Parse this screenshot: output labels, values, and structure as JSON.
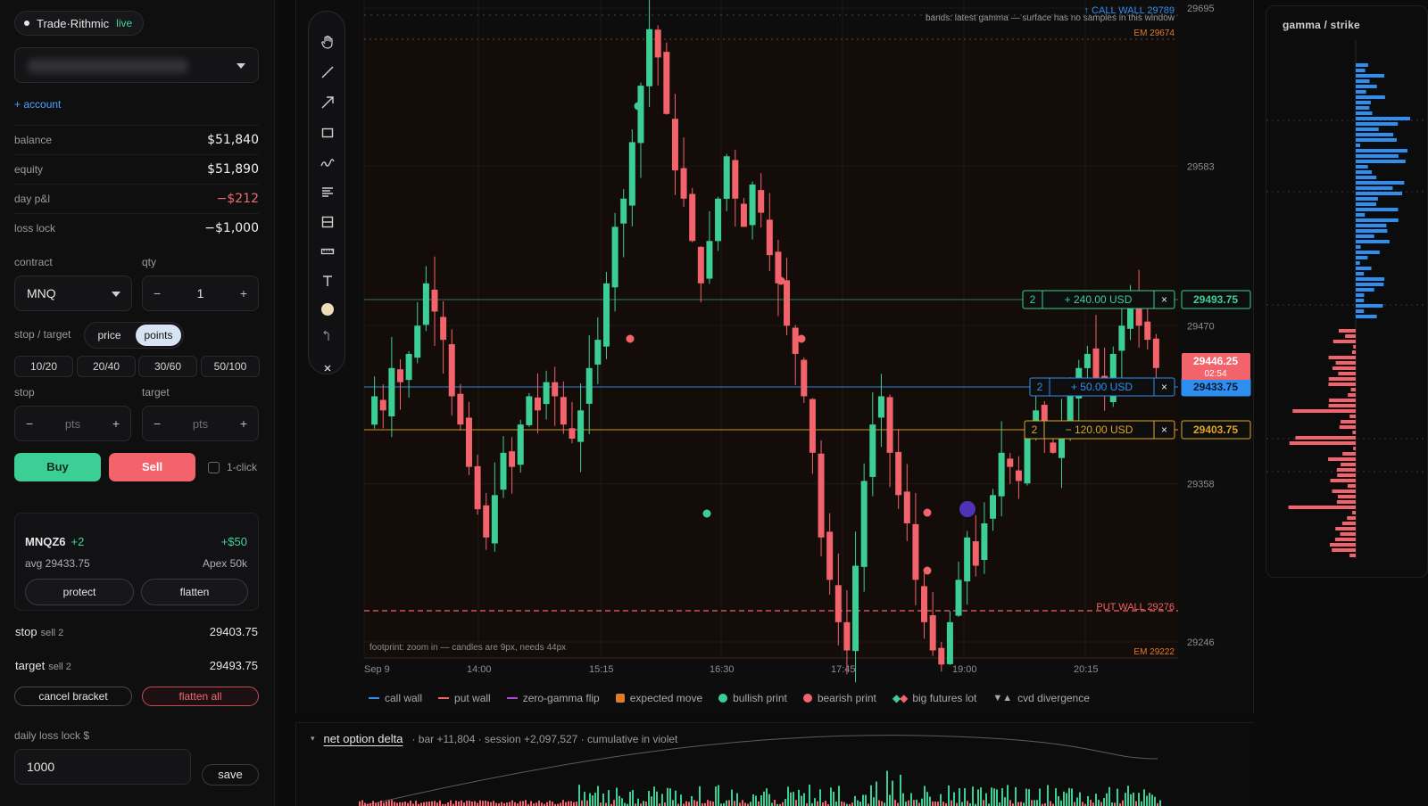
{
  "broker": {
    "name": "Trade·Rithmic",
    "status": "live"
  },
  "account": {
    "add_label": "+ account"
  },
  "stats": [
    {
      "key": "balance",
      "value": "$51,840",
      "negative": false
    },
    {
      "key": "equity",
      "value": "$51,890",
      "negative": false
    },
    {
      "key": "day p&l",
      "value": "−$212",
      "negative": true
    },
    {
      "key": "loss lock",
      "value": "−$1,000",
      "negative": false
    }
  ],
  "order_form": {
    "contract_label": "contract",
    "contract_value": "MNQ",
    "qty_label": "qty",
    "qty_value": "1",
    "minus": "−",
    "plus": "+",
    "stop_target_label": "stop / target",
    "mode_options": [
      "price",
      "points"
    ],
    "mode_selected": "points",
    "presets": [
      "10/20",
      "20/40",
      "30/60",
      "50/100"
    ],
    "stop_label": "stop",
    "target_label": "target",
    "pts_placeholder": "pts",
    "buy_label": "Buy",
    "sell_label": "Sell",
    "one_click_label": "1-click"
  },
  "position": {
    "symbol": "MNQZ6",
    "count": "+2",
    "pnl": "+$50",
    "avg": "avg 29433.75",
    "account": "Apex 50k",
    "protect_label": "protect",
    "flatten_label": "flatten"
  },
  "working_orders": [
    {
      "kind": "stop",
      "side": "sell 2",
      "price": "29403.75"
    },
    {
      "kind": "target",
      "side": "sell 2",
      "price": "29493.75"
    }
  ],
  "actions": {
    "cancel_bracket": "cancel bracket",
    "flatten_all": "flatten all"
  },
  "loss_lock": {
    "label": "daily loss lock $",
    "value": "1000",
    "save_label": "save"
  },
  "chart": {
    "price_axis": [
      "29695",
      "29583",
      "29470",
      "29358",
      "29246"
    ],
    "time_axis": [
      "Sep 9",
      "14:00",
      "15:15",
      "16:30",
      "17:45",
      "19:00",
      "20:15"
    ],
    "call_wall_label": "↑ CALL WALL 29789",
    "bands_note": "bands: latest gamma — surface has no samples in this window",
    "em_upper": "EM 29674",
    "em_lower": "EM 29222",
    "put_wall_label": "PUT WALL 29276",
    "footprint_note": "footprint: zoom in — candles are 9px, needs 44px",
    "last_price": "29446.25",
    "countdown": "02:54",
    "orders": [
      {
        "qty": "2",
        "pnl": "+ 240.00 USD",
        "price": "29493.75",
        "color": "#3ccf95"
      },
      {
        "qty": "2",
        "pnl": "+ 50.00 USD",
        "price": "29433.75",
        "color": "#2f8ff0"
      },
      {
        "qty": "2",
        "pnl": "− 120.00 USD",
        "price": "29403.75",
        "color": "#e0a623"
      }
    ],
    "close_glyph": "×",
    "colors": {
      "up": "#3ccf95",
      "down": "#f2636c",
      "call_wall": "#2f8ff0",
      "put_wall": "#f2636c",
      "em": "#e07b2a"
    }
  },
  "legend": [
    {
      "label": "call wall",
      "swatch": "line",
      "color": "#2f8ff0"
    },
    {
      "label": "put wall",
      "swatch": "line",
      "color": "#f2636c"
    },
    {
      "label": "zero-gamma flip",
      "swatch": "line",
      "color": "#b04ad8"
    },
    {
      "label": "expected move",
      "swatch": "square",
      "color": "#e07b2a"
    },
    {
      "label": "bullish print",
      "swatch": "dot",
      "color": "#3ccf95"
    },
    {
      "label": "bearish print",
      "swatch": "dot",
      "color": "#f2636c"
    },
    {
      "label": "big futures lot",
      "swatch": "diamonds",
      "color": "#3ccf95"
    },
    {
      "label": "cvd divergence",
      "swatch": "triangles",
      "color": "#a9a9ad"
    }
  ],
  "legend_glyphs": {
    "diamonds": "◆◆",
    "triangles": "▼▲"
  },
  "gamma_panel": {
    "title": "gamma / strike"
  },
  "delta_panel": {
    "title": "net option delta",
    "meta": "· bar +11,804 · session +2,097,527 · cumulative in violet"
  },
  "tools": [
    "hand-icon",
    "line-icon",
    "arrow-icon",
    "rectangle-icon",
    "path-icon",
    "text-align-icon",
    "layout-icon",
    "ruler-icon",
    "text-icon",
    "color-dot-icon",
    "undo-icon",
    "close-icon"
  ]
}
